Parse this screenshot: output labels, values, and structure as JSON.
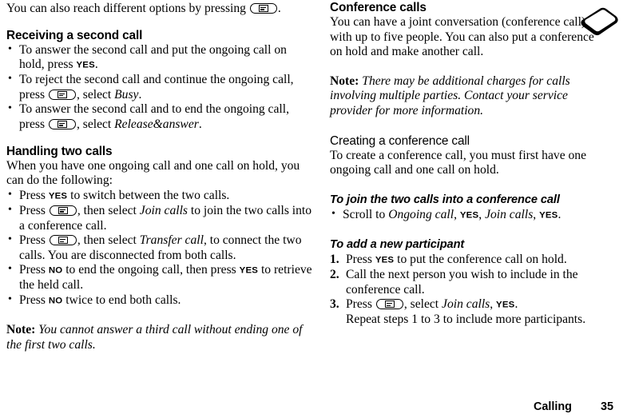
{
  "document": {
    "footer": {
      "section": "Calling",
      "page_number": "35"
    },
    "icons": {
      "menu_key": "menu-key-icon",
      "device": "mobile-phone-icon"
    }
  },
  "left_column": {
    "intro": {
      "text_before_key": "You can also reach different options by pressing ",
      "text_after_key": "."
    },
    "heading_receiving": "Receiving a second call",
    "receiving_items": [
      {
        "parts": [
          {
            "type": "text",
            "value": "To answer the second call and put the ongoing call on hold, press "
          },
          {
            "type": "key",
            "value": "YES"
          },
          {
            "type": "text",
            "value": "."
          }
        ]
      },
      {
        "parts": [
          {
            "type": "text",
            "value": "To reject the second call and continue the ongoing call, press "
          },
          {
            "type": "menukey",
            "value": "menu-key-icon"
          },
          {
            "type": "text",
            "value": ", select "
          },
          {
            "type": "italic",
            "value": "Busy"
          },
          {
            "type": "text",
            "value": "."
          }
        ]
      },
      {
        "parts": [
          {
            "type": "text",
            "value": "To answer the second call and to end the ongoing call, press "
          },
          {
            "type": "menukey",
            "value": "menu-key-icon"
          },
          {
            "type": "text",
            "value": ", select "
          },
          {
            "type": "italic",
            "value": "Release&answer"
          },
          {
            "type": "text",
            "value": "."
          }
        ]
      }
    ],
    "heading_handling": "Handling two calls",
    "handling_intro": "When you have one ongoing call and one call on hold, you can do the following:",
    "handling_items": [
      {
        "parts": [
          {
            "type": "text",
            "value": "Press "
          },
          {
            "type": "key",
            "value": "YES"
          },
          {
            "type": "text",
            "value": " to switch between the two calls."
          }
        ]
      },
      {
        "parts": [
          {
            "type": "text",
            "value": "Press "
          },
          {
            "type": "menukey",
            "value": "menu-key-icon"
          },
          {
            "type": "text",
            "value": ", then select "
          },
          {
            "type": "italic",
            "value": "Join calls"
          },
          {
            "type": "text",
            "value": " to join the two calls into a conference call."
          }
        ]
      },
      {
        "parts": [
          {
            "type": "text",
            "value": "Press "
          },
          {
            "type": "menukey",
            "value": "menu-key-icon"
          },
          {
            "type": "text",
            "value": ", then select "
          },
          {
            "type": "italic",
            "value": "Transfer call"
          },
          {
            "type": "text",
            "value": ", to connect the two calls. You are disconnected from both calls."
          }
        ]
      },
      {
        "parts": [
          {
            "type": "text",
            "value": "Press "
          },
          {
            "type": "key",
            "value": "NO"
          },
          {
            "type": "text",
            "value": " to end the ongoing call, then press "
          },
          {
            "type": "key",
            "value": "YES"
          },
          {
            "type": "text",
            "value": " to retrieve the held call."
          }
        ]
      },
      {
        "parts": [
          {
            "type": "text",
            "value": "Press "
          },
          {
            "type": "key",
            "value": "NO"
          },
          {
            "type": "text",
            "value": " twice to end both calls."
          }
        ]
      }
    ],
    "note": {
      "label": "Note:",
      "text": "You cannot answer a third call without ending one of the first two calls."
    }
  },
  "right_column": {
    "heading_conference": "Conference calls",
    "conference_intro": "You can have a joint conversation (conference call) with up to five people. You can also put a conference on hold and make another call.",
    "note": {
      "label": "Note:",
      "text": "There may be additional charges for calls involving multiple parties. Contact your service provider for more information."
    },
    "heading_creating": "Creating a conference call",
    "creating_intro": "To create a conference call, you must first have one ongoing call and one call on hold.",
    "subheading_join": "To join the two calls into a conference call",
    "join_items": [
      {
        "parts": [
          {
            "type": "text",
            "value": "Scroll to "
          },
          {
            "type": "italic",
            "value": "Ongoing call"
          },
          {
            "type": "text",
            "value": ", "
          },
          {
            "type": "key",
            "value": "YES"
          },
          {
            "type": "text",
            "value": ", "
          },
          {
            "type": "italic",
            "value": "Join calls"
          },
          {
            "type": "text",
            "value": ", "
          },
          {
            "type": "key",
            "value": "YES"
          },
          {
            "type": "text",
            "value": "."
          }
        ]
      }
    ],
    "subheading_add": "To add a new participant",
    "add_items": [
      {
        "number": "1.",
        "parts": [
          {
            "type": "text",
            "value": "Press "
          },
          {
            "type": "key",
            "value": "YES"
          },
          {
            "type": "text",
            "value": " to put the conference call on hold."
          }
        ]
      },
      {
        "number": "2.",
        "parts": [
          {
            "type": "text",
            "value": "Call the next person you wish to include in the conference call."
          }
        ]
      },
      {
        "number": "3.",
        "parts": [
          {
            "type": "text",
            "value": "Press "
          },
          {
            "type": "menukey",
            "value": "menu-key-icon"
          },
          {
            "type": "text",
            "value": ", select "
          },
          {
            "type": "italic",
            "value": "Join calls"
          },
          {
            "type": "text",
            "value": ", "
          },
          {
            "type": "key",
            "value": "YES"
          },
          {
            "type": "text",
            "value": "."
          },
          {
            "type": "break",
            "value": ""
          },
          {
            "type": "text",
            "value": "Repeat steps 1 to 3 to include more participants."
          }
        ]
      }
    ]
  }
}
